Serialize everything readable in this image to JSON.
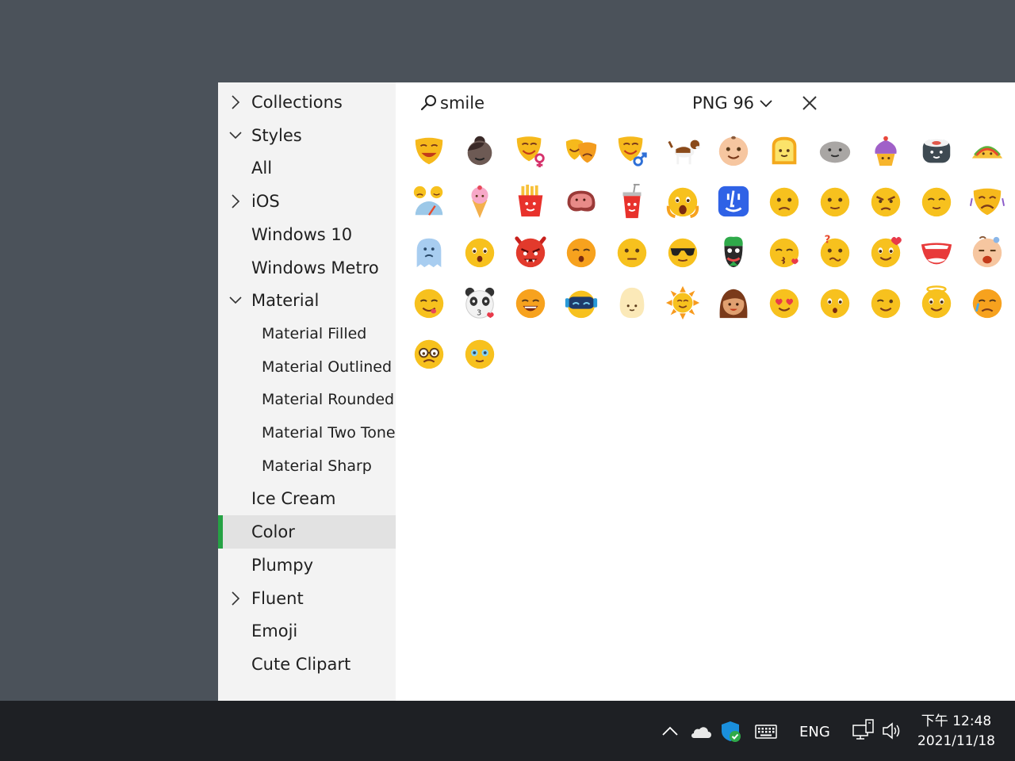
{
  "sidebar": {
    "items": [
      {
        "label": "Collections",
        "indent": 0,
        "chevron": "right"
      },
      {
        "label": "Styles",
        "indent": 0,
        "chevron": "down"
      },
      {
        "label": "All",
        "indent": 1,
        "chevron": "none"
      },
      {
        "label": "iOS",
        "indent": 1,
        "chevron": "right"
      },
      {
        "label": "Windows 10",
        "indent": 1,
        "chevron": "none"
      },
      {
        "label": "Windows Metro",
        "indent": 1,
        "chevron": "none"
      },
      {
        "label": "Material",
        "indent": 1,
        "chevron": "down"
      },
      {
        "label": "Material Filled",
        "indent": 2,
        "chevron": "none"
      },
      {
        "label": "Material Outlined",
        "indent": 2,
        "chevron": "none"
      },
      {
        "label": "Material Rounded",
        "indent": 2,
        "chevron": "none"
      },
      {
        "label": "Material Two Tone",
        "indent": 2,
        "chevron": "none"
      },
      {
        "label": "Material Sharp",
        "indent": 2,
        "chevron": "none"
      },
      {
        "label": "Ice Cream",
        "indent": 1,
        "chevron": "none"
      },
      {
        "label": "Color",
        "indent": 1,
        "chevron": "none",
        "selected": true
      },
      {
        "label": "Plumpy",
        "indent": 1,
        "chevron": "none"
      },
      {
        "label": "Fluent",
        "indent": 1,
        "chevron": "right"
      },
      {
        "label": "Emoji",
        "indent": 1,
        "chevron": "none"
      },
      {
        "label": "Cute Clipart",
        "indent": 1,
        "chevron": "none"
      }
    ],
    "accent_color": "#25a244"
  },
  "toolbar": {
    "search_value": "smile",
    "search_icon": "search-icon",
    "clear_icon": "close-icon",
    "format_value": "PNG 96",
    "color_swatch": "#000000",
    "settings_icon": "gear-icon",
    "minimize_icon": "minimize-icon",
    "close_icon": "close-icon"
  },
  "icons": [
    "theater-mask-smile-icon",
    "face-with-bun-icon",
    "woman-mask-icon",
    "drama-masks-icon",
    "man-mask-icon",
    "beagle-dog-icon",
    "baby-face-icon",
    "toast-icon",
    "stone-face-icon",
    "cupcake-icon",
    "sushi-roll-icon",
    "taco-icon",
    "mood-meter-icon",
    "ice-cream-cone-icon",
    "french-fries-icon",
    "steak-icon",
    "soda-cup-icon",
    "screaming-face-icon",
    "finder-face-icon",
    "slightly-frowning-face-icon",
    "neutral-face-icon",
    "angry-face-icon",
    "relieved-face-icon",
    "sad-mask-icon",
    "ghost-icon",
    "hushed-face-icon",
    "devil-face-icon",
    "surprised-face-icon",
    "expressionless-face-icon",
    "sunglasses-face-icon",
    "joker-icon",
    "kissing-face-icon",
    "confused-face-icon",
    "love-face-icon",
    "big-smile-mouth-icon",
    "crying-baby-icon",
    "yummy-face-icon",
    "panda-kiss-icon",
    "grinning-face-icon",
    "astronaut-face-icon",
    "egg-face-icon",
    "sun-face-icon",
    "woman-face-icon",
    "heart-eyes-face-icon",
    "worried-face-icon",
    "smiling-face-icon",
    "halo-face-icon",
    "disappointed-face-icon",
    "nerd-glasses-face-icon",
    "teary-eyes-face-icon"
  ],
  "taskbar": {
    "language": "ENG",
    "time": "下午 12:48",
    "date": "2021/11/18"
  }
}
